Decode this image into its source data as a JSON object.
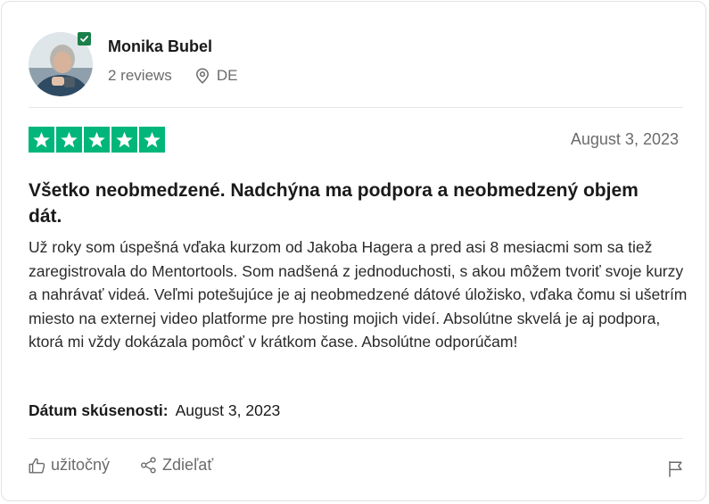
{
  "reviewer": {
    "name": "Monika Bubel",
    "reviews_count": "2 reviews",
    "country": "DE",
    "verified": true
  },
  "review": {
    "rating": 5,
    "max_rating": 5,
    "date": "August 3, 2023",
    "title": "Všetko neobmedzené. Nadchýna ma podpora a neobmedzený objem dát.",
    "body": "Už roky som úspešná vďaka kurzom od Jakoba Hagera a pred asi 8 mesiacmi som sa tiež zaregistrovala do Mentortools. Som nadšená z jednoduchosti, s akou môžem tvoriť svoje kurzy a nahrávať videá. Veľmi potešujúce je aj neobmedzené dátové úložisko, vďaka čomu si ušetrím miesto na externej video platforme pre hosting mojich videí. Absolútne skvelá je aj podpora, ktorá mi vždy dokázala pomôcť v krátkom čase. Absolútne odporúčam!",
    "experience_label": "Dátum skúsenosti:",
    "experience_date": "August 3, 2023"
  },
  "actions": {
    "useful_label": "užitočný",
    "share_label": "Zdieľať"
  },
  "icons": {
    "location": "location-pin-icon",
    "useful": "thumbs-up-icon",
    "share": "share-icon",
    "flag": "flag-icon",
    "verified": "checkmark-icon",
    "star": "star-icon"
  },
  "colors": {
    "star_green": "#00b67a",
    "verified_green": "#1b7f4a",
    "muted_text": "#6b6b6b"
  }
}
